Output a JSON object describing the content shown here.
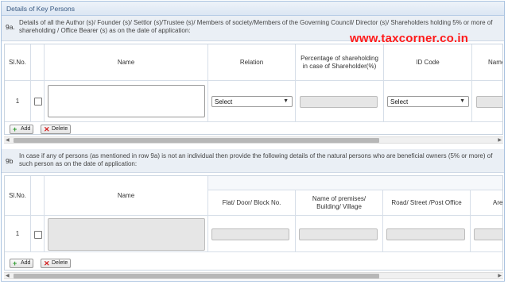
{
  "section": {
    "title": "Details of Key Persons"
  },
  "watermark": "www.taxcorner.co.in",
  "row9a": {
    "num": "9a.",
    "description": "Details of all the Author (s)/ Founder (s)/ Settlor (s)/Trustee (s)/ Members of society/Members of the Governing Council/ Director (s)/ Shareholders holding 5% or more of shareholding / Office Bearer (s) as on the date of application:",
    "headers": {
      "slno": "Sl.No.",
      "name": "Name",
      "relation": "Relation",
      "pct": "Percentage of shareholding in case of Shareholder(%)",
      "idcode": "ID Code",
      "more": "Name"
    },
    "row": {
      "slno": "1",
      "relation_selected": "Select",
      "idcode_selected": "Select"
    },
    "buttons": {
      "add": "Add",
      "delete": "Delete"
    }
  },
  "row9b": {
    "num": "9b",
    "description": "In case if any of persons (as mentioned in row 9a) is not an individual then provide the following details of the natural persons who are beneficial owners (5% or more) of such person as on the date of application:",
    "headers": {
      "slno": "Sl.No.",
      "name": "Name",
      "flat": "Flat/ Door/ Block No.",
      "premises": "Name of premises/ Building/ Village",
      "road": "Road/ Street /Post Office",
      "area": "Are"
    },
    "row": {
      "slno": "1"
    },
    "buttons": {
      "add": "Add",
      "delete": "Delete"
    }
  },
  "icons": {
    "add": "plus-icon",
    "delete": "x-icon",
    "caret": "chevron-down-icon"
  },
  "colors": {
    "watermark": "#ff1a1a",
    "header_text": "#3a5a82",
    "add_icon": "#2e9b2e",
    "delete_icon": "#d32020"
  }
}
